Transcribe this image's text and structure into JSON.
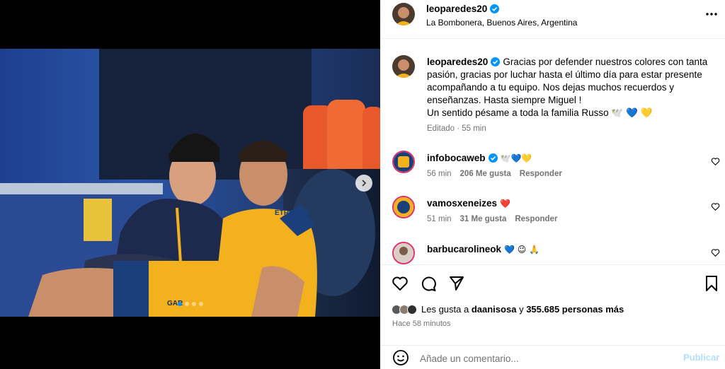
{
  "post": {
    "author": "leoparedes20",
    "location": "La Bombonera, Buenos Aires, Argentina"
  },
  "media": {
    "carousel_total": 4,
    "carousel_active": 1,
    "shirt_text": "ETROGAR",
    "bench_text": "GAR"
  },
  "caption": {
    "username": "leoparedes20",
    "text": "Gracias por defender nuestros colores con tanta pasión, gracias por luchar hasta el último día para estar presente acompañando a tu equipo. Nos dejas muchos recuerdos y enseñanzas. Hasta siempre Miguel !\nUn sentido pésame a toda la familia Russo 🕊️ 💙 💛",
    "edited": "Editado · 55 min"
  },
  "comments": [
    {
      "username": "infobocaweb",
      "text": "🕊️💙💛",
      "time": "56 min",
      "likes": "206 Me gusta",
      "reply": "Responder"
    },
    {
      "username": "vamosxeneizes",
      "text": "❤️",
      "time": "51 min",
      "likes": "31 Me gusta",
      "reply": "Responder"
    },
    {
      "username": "barbucarolineok",
      "text": "💙 😉 🙏",
      "time": "",
      "likes": "",
      "reply": ""
    }
  ],
  "likes": {
    "prefix": "Les gusta a",
    "first_user": "daanisosa",
    "connector": "y",
    "others": "355.685 personas más"
  },
  "timestamp": "Hace 58 minutos",
  "composer": {
    "placeholder": "Añade un comentario...",
    "publish": "Publicar"
  },
  "colors": {
    "accent": "#0095f6",
    "publish_disabled": "#b2dffc",
    "boca_blue": "#1a3f7a",
    "boca_yellow": "#f3b21d"
  }
}
